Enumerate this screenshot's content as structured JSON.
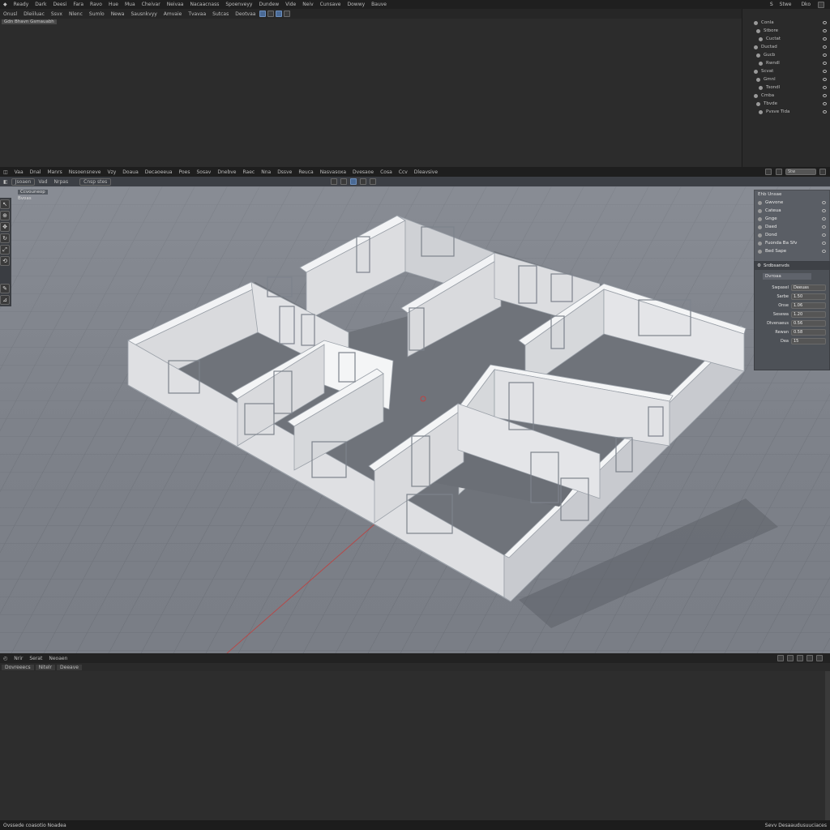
{
  "topbar": {
    "menus": [
      "Ready",
      "Dark",
      "Deesi",
      "Fara",
      "Ravo",
      "Hue",
      "Mua",
      "Cheivar",
      "Neivaa",
      "Nacaacnass",
      "Spoenveyy",
      "Dundew",
      "Vide",
      "Neiv",
      "Cunsave",
      "Dowwy",
      "Bauve"
    ],
    "right": {
      "icon": "S",
      "label": "Stwe",
      "label2": "Dko"
    }
  },
  "top_toolbar": {
    "left": [
      "Onusl",
      "Dleiiluac",
      "Ssvx",
      "Nlenc",
      "Sumlo",
      "Newa",
      "Sausnkvyy",
      "Amvaie",
      "Tvavaa",
      "Sutcas",
      "Deotvaa"
    ]
  },
  "top_viewport": {
    "label": "Gdn Bhavn Gsmauabh"
  },
  "outliner_top": {
    "items": [
      "Conla",
      "Stbore",
      "Cuctat",
      "Ductad",
      "Gucb",
      "Rwndl",
      "Scvat",
      "Gmnl",
      "Tsondl",
      "Cmba",
      "Tbvde",
      "Pvsve Tida"
    ]
  },
  "mid_header": {
    "menus": [
      "Vaa",
      "Dnal",
      "Manrs",
      "Nssoensneve",
      "Vzy",
      "Doaua",
      "Decaoeeua",
      "Poes",
      "Sosav",
      "Dnebve",
      "Raec",
      "Nna",
      "Dssve",
      "Reuca",
      "Nasvasoxa",
      "Dvesaoe",
      "Cosa",
      "Ccv",
      "Dleavsive"
    ],
    "right": {
      "label": "Stw"
    }
  },
  "viewport_toolbar": {
    "mode": "Jsoaen",
    "view": "Vad",
    "shading": "Nrpas",
    "object": "Cnsp stes"
  },
  "viewport": {
    "overlay1": "Ccvouneop",
    "overlay2": "Bvoas"
  },
  "mini_outliner": {
    "title": "Ehb Unsae",
    "items": [
      "Gwvone",
      "Cateua",
      "Gnge",
      "Daed",
      "Dond",
      "Fuonda Ba Sfv",
      "Bed Sape"
    ]
  },
  "props": {
    "title": "Srdbsanvds",
    "tab": "Dvroaa",
    "rows": [
      {
        "label": "Swpasel",
        "value": "Deeuas"
      },
      {
        "label": "Sarbe",
        "value": "1.50"
      },
      {
        "label": "Onse",
        "value": "1.06"
      },
      {
        "label": "Sesewa",
        "value": "1.20"
      },
      {
        "label": "Dtvenaeus",
        "value": "0.56"
      },
      {
        "label": "Rewan",
        "value": "0.58"
      },
      {
        "label": "Dea",
        "value": "15"
      }
    ]
  },
  "timeline": {
    "menus": [
      "Nrir",
      "Serat",
      "Neoaen"
    ],
    "sub": [
      "Dovreeecs",
      "Nitelr",
      "Deeave"
    ]
  },
  "status": {
    "left": "Ovssede coasotio Noadea",
    "right": "Sevv Desaaudusuuciaces"
  },
  "colors": {
    "accent": "#4a6a95",
    "grid": "#7c8088",
    "wall": "#e2e3e6",
    "floor": "#6f737a"
  }
}
